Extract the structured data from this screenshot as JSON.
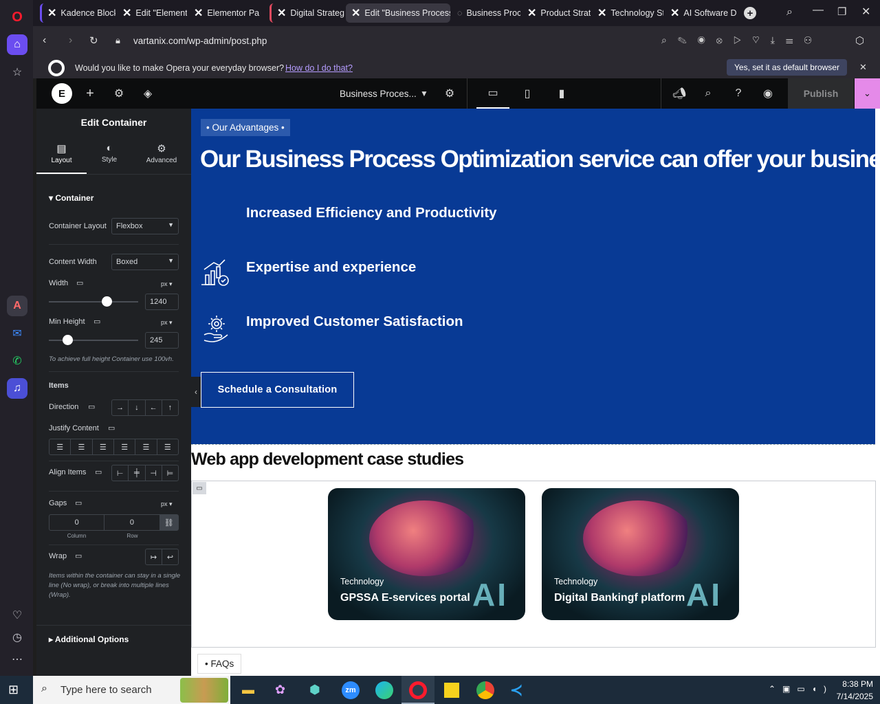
{
  "browser": {
    "tabs": [
      {
        "label": "Kadence Block"
      },
      {
        "label": "Edit \"Elemento"
      },
      {
        "label": "Elementor Pa"
      },
      {
        "label": "Digital Strateg"
      },
      {
        "label": "Edit \"Business Process O"
      },
      {
        "label": "Business Proc"
      },
      {
        "label": "Product Strate"
      },
      {
        "label": "Technology St"
      },
      {
        "label": "AI Software D"
      }
    ],
    "url": "vartanix.com/wp-admin/post.php",
    "banner_text": "Would you like to make Opera your everyday browser?",
    "banner_link": "How do I do that?",
    "banner_button": "Yes, set it as default browser"
  },
  "elementor_header": {
    "page_name": "Business Proces...",
    "publish": "Publish"
  },
  "panel": {
    "title": "Edit Container",
    "tabs": [
      "Layout",
      "Style",
      "Advanced"
    ],
    "section": "Container",
    "container_layout_label": "Container Layout",
    "container_layout_value": "Flexbox",
    "content_width_label": "Content Width",
    "content_width_value": "Boxed",
    "width_label": "Width",
    "width_unit": "px",
    "width_value": "1240",
    "width_slider_fraction": 0.67,
    "min_height_label": "Min Height",
    "min_height_unit": "px",
    "min_height_value": "245",
    "min_height_slider_fraction": 0.17,
    "min_height_hint": "To achieve full height Container use 100vh.",
    "items_label": "Items",
    "direction_label": "Direction",
    "justify_label": "Justify Content",
    "align_label": "Align Items",
    "gaps_label": "Gaps",
    "gaps_unit": "px",
    "gap_column": "0",
    "gap_row": "0",
    "gap_column_label": "Column",
    "gap_row_label": "Row",
    "wrap_label": "Wrap",
    "wrap_hint": "Items within the container can stay in a single line (No wrap), or break into multiple lines (Wrap).",
    "additional": "Additional Options"
  },
  "canvas": {
    "badge": "• Our Advantages •",
    "heading": "Our Business Process Optimization service can offer your business:",
    "items": [
      {
        "text": "Increased Efficiency and Productivity"
      },
      {
        "text": "Expertise and experience"
      },
      {
        "text": "Improved Customer Satisfaction"
      }
    ],
    "cta": "Schedule a Consultation",
    "case_heading": "Web app development case studies",
    "cards": [
      {
        "category": "Technology",
        "title": "GPSSA E-services portal",
        "ai": "AI"
      },
      {
        "category": "Technology",
        "title": "Digital Bankingf platform",
        "ai": "AI"
      }
    ],
    "faqs": "• FAQs"
  },
  "taskbar": {
    "search_placeholder": "Type here to search",
    "time": "8:38 PM",
    "date": "7/14/2025"
  },
  "colors": {
    "hero_bg": "#083a95",
    "publish_bg": "#e58ae9"
  }
}
